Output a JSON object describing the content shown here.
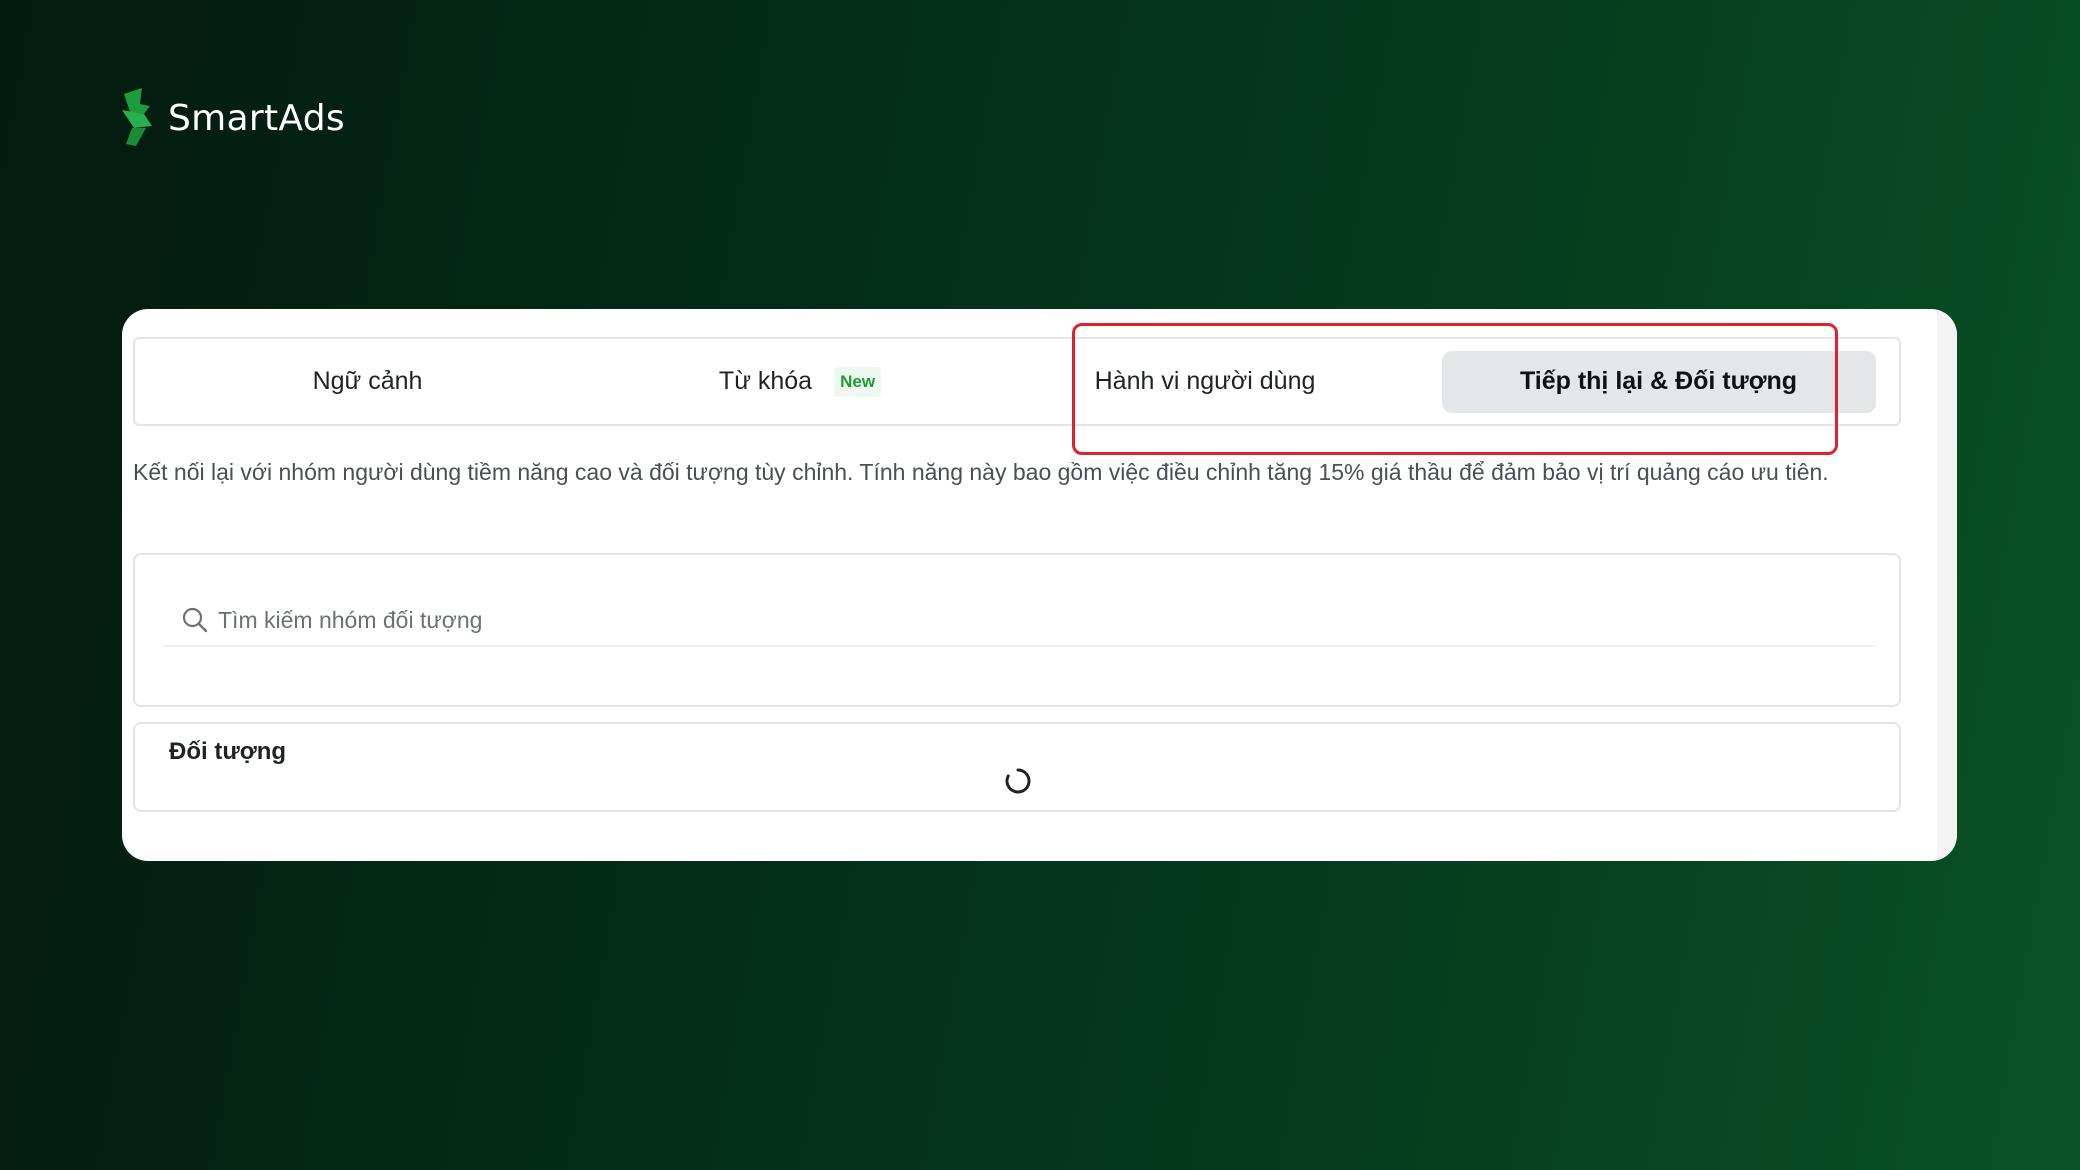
{
  "brand": {
    "name": "SmartAds",
    "logo_icon": "smartads-logo-icon",
    "accent_color": "#1f9a3a"
  },
  "tabs": [
    {
      "label": "Ngữ cảnh",
      "selected": false
    },
    {
      "label": "Từ khóa",
      "badge": "New",
      "selected": false
    },
    {
      "label": "Hành vi người dùng",
      "selected": false
    },
    {
      "label": "Tiếp thị lại & Đối tượng",
      "selected": true
    }
  ],
  "highlight_color": "#e0202a",
  "description": "Kết nối lại với nhóm người dùng tiềm năng cao và đối tượng tùy chỉnh. Tính năng này bao gồm việc điều chỉnh tăng 15% giá thầu để đảm bảo vị trí quảng cáo ưu tiên.",
  "search": {
    "icon": "search-icon",
    "placeholder": "Tìm kiếm nhóm đối tượng",
    "value": ""
  },
  "audience": {
    "title": "Đối tượng",
    "loading_icon": "loading-spinner-icon"
  }
}
